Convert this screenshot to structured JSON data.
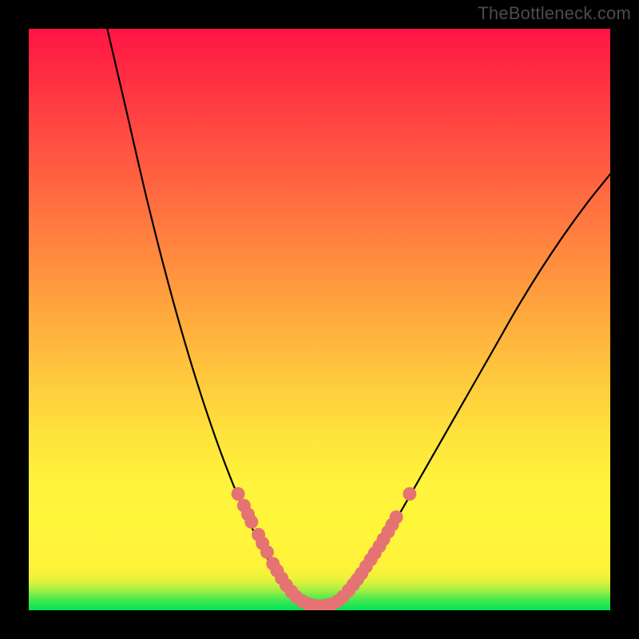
{
  "watermark": "TheBottleneck.com",
  "chart_data": {
    "type": "line",
    "title": "",
    "xlabel": "",
    "ylabel": "",
    "xlim": [
      0,
      100
    ],
    "ylim": [
      0,
      100
    ],
    "grid": false,
    "legend": false,
    "curve_points": [
      {
        "x": 13.5,
        "y": 100
      },
      {
        "x": 17,
        "y": 85
      },
      {
        "x": 20,
        "y": 72
      },
      {
        "x": 23,
        "y": 60
      },
      {
        "x": 26,
        "y": 49
      },
      {
        "x": 29,
        "y": 39
      },
      {
        "x": 32,
        "y": 30
      },
      {
        "x": 35,
        "y": 22
      },
      {
        "x": 38,
        "y": 15
      },
      {
        "x": 41,
        "y": 9
      },
      {
        "x": 43.5,
        "y": 5
      },
      {
        "x": 46,
        "y": 2
      },
      {
        "x": 48,
        "y": 0.8
      },
      {
        "x": 50,
        "y": 0.5
      },
      {
        "x": 52,
        "y": 0.8
      },
      {
        "x": 54,
        "y": 2
      },
      {
        "x": 57,
        "y": 5.5
      },
      {
        "x": 60,
        "y": 10
      },
      {
        "x": 64,
        "y": 17
      },
      {
        "x": 68,
        "y": 24
      },
      {
        "x": 72,
        "y": 31
      },
      {
        "x": 76,
        "y": 38
      },
      {
        "x": 80,
        "y": 45
      },
      {
        "x": 84,
        "y": 52
      },
      {
        "x": 88,
        "y": 58.5
      },
      {
        "x": 92,
        "y": 64.5
      },
      {
        "x": 96,
        "y": 70
      },
      {
        "x": 100,
        "y": 75
      }
    ],
    "highlight_dots": [
      {
        "x": 36,
        "y": 20
      },
      {
        "x": 37,
        "y": 18
      },
      {
        "x": 37.7,
        "y": 16.5
      },
      {
        "x": 38.3,
        "y": 15.2
      },
      {
        "x": 39.5,
        "y": 13
      },
      {
        "x": 40.2,
        "y": 11.5
      },
      {
        "x": 41,
        "y": 10
      },
      {
        "x": 42,
        "y": 8
      },
      {
        "x": 42.7,
        "y": 6.8
      },
      {
        "x": 43.5,
        "y": 5.5
      },
      {
        "x": 44.3,
        "y": 4.3
      },
      {
        "x": 45.2,
        "y": 3.2
      },
      {
        "x": 46,
        "y": 2.3
      },
      {
        "x": 47,
        "y": 1.6
      },
      {
        "x": 48,
        "y": 1.1
      },
      {
        "x": 49,
        "y": 0.8
      },
      {
        "x": 50,
        "y": 0.7
      },
      {
        "x": 51,
        "y": 0.8
      },
      {
        "x": 52,
        "y": 1.0
      },
      {
        "x": 53,
        "y": 1.5
      },
      {
        "x": 54,
        "y": 2.3
      },
      {
        "x": 55,
        "y": 3.4
      },
      {
        "x": 55.8,
        "y": 4.4
      },
      {
        "x": 56.5,
        "y": 5.3
      },
      {
        "x": 57.2,
        "y": 6.3
      },
      {
        "x": 58,
        "y": 7.5
      },
      {
        "x": 58.8,
        "y": 8.7
      },
      {
        "x": 59.5,
        "y": 9.8
      },
      {
        "x": 60.3,
        "y": 11
      },
      {
        "x": 61,
        "y": 12.2
      },
      {
        "x": 61.8,
        "y": 13.5
      },
      {
        "x": 62.5,
        "y": 14.7
      },
      {
        "x": 63.2,
        "y": 16
      },
      {
        "x": 65.5,
        "y": 20
      }
    ],
    "colors": {
      "curve": "#000000",
      "dots": "#e57373",
      "gradient_top": "#ff1543",
      "gradient_bottom": "#00e558"
    }
  }
}
